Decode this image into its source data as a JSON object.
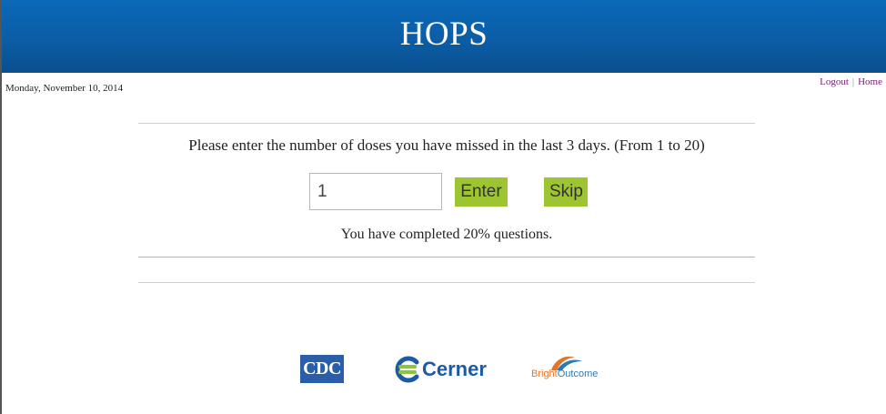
{
  "header": {
    "title": "HOPS"
  },
  "date_text": "Monday, November 10, 2014",
  "nav": {
    "logout_label": "Logout",
    "separator": "|",
    "home_label": "Home"
  },
  "question": {
    "text": "Please enter the number of doses you have missed in the last 3 days. (From 1 to 20)",
    "input_value": "1",
    "enter_label": "Enter",
    "skip_label": "Skip"
  },
  "progress": {
    "text": "You have completed 20% questions.",
    "percent": 20
  },
  "footer_logos": {
    "cdc": "CDC",
    "cerner": "Cerner",
    "bright_part1": "Bright",
    "bright_part2": "Outcome"
  },
  "colors": {
    "header_blue": "#0b5da5",
    "button_green": "#9dc531",
    "link_purple": "#7a1a7a"
  }
}
